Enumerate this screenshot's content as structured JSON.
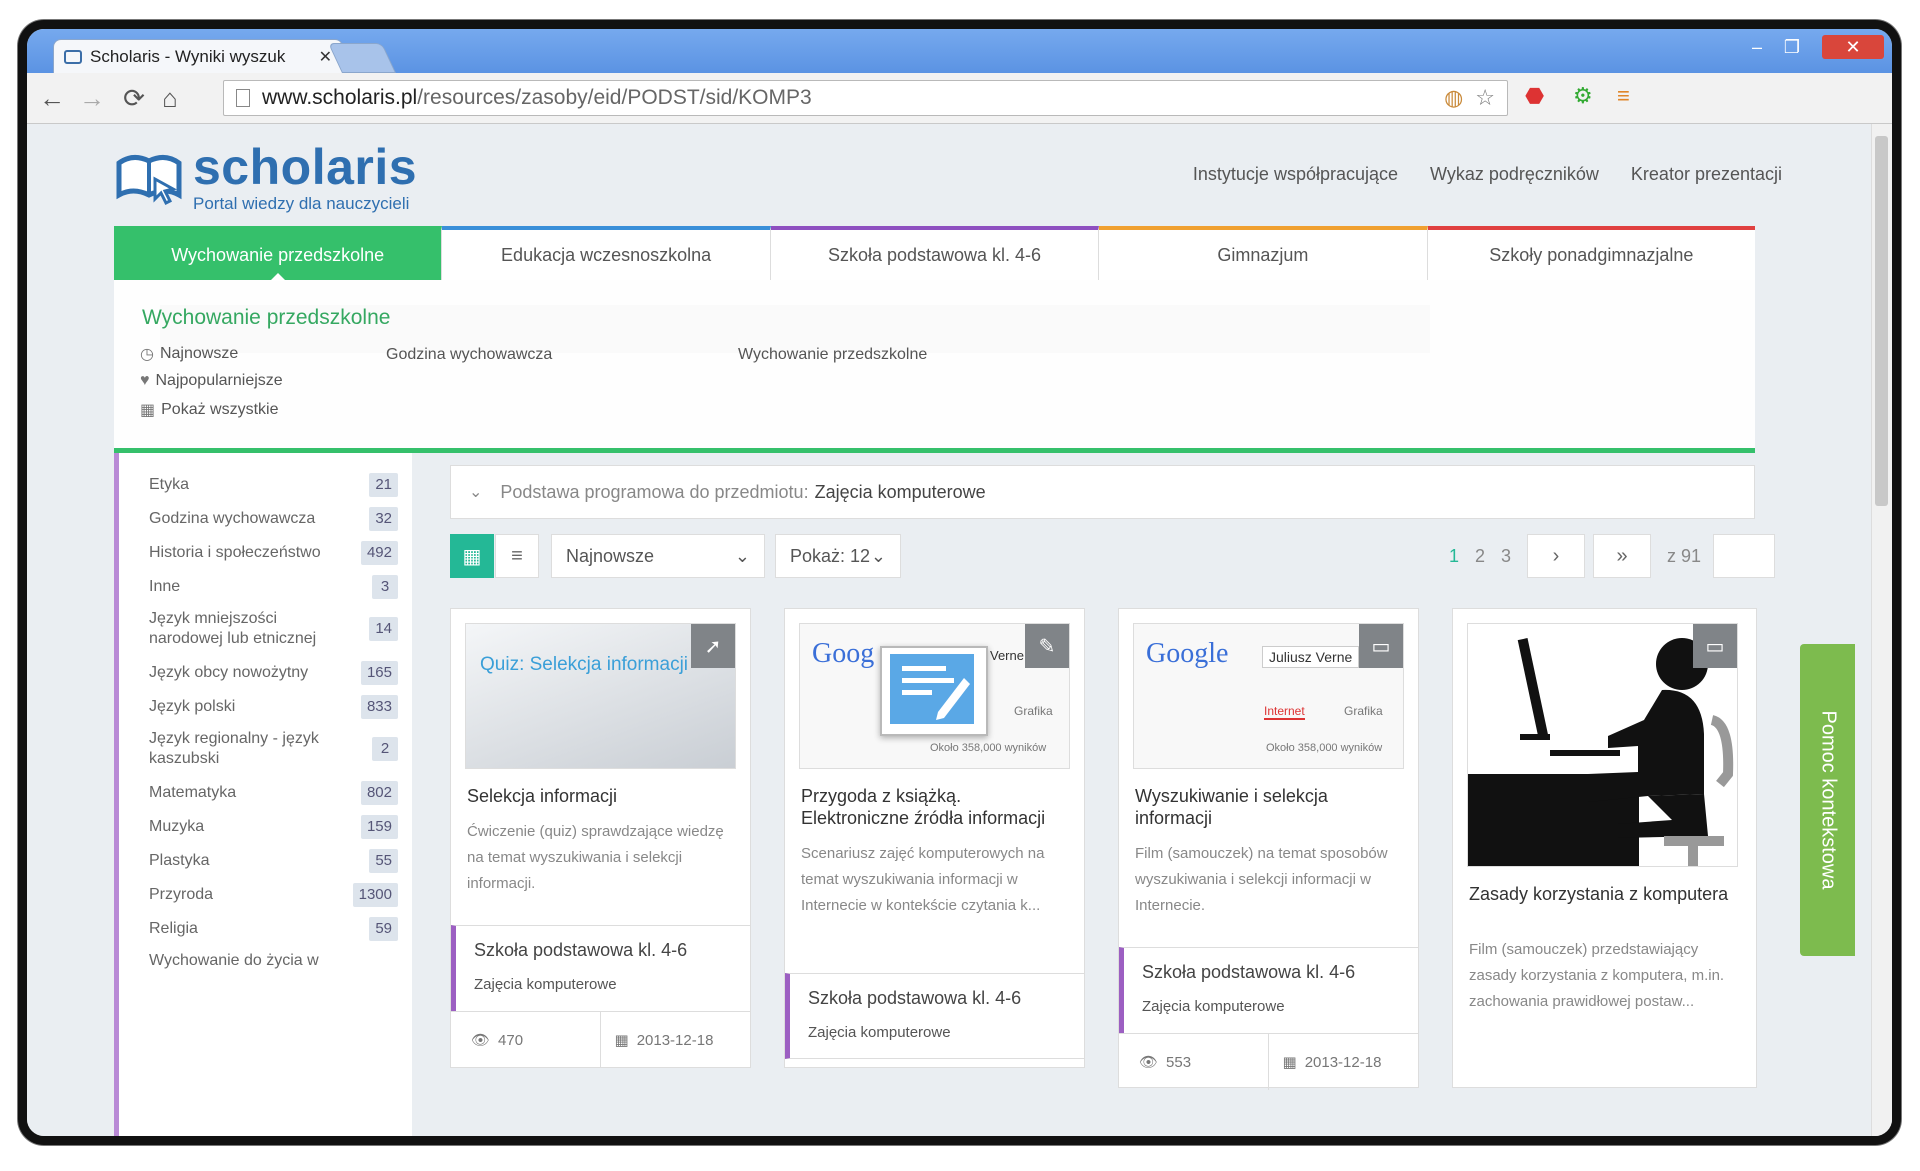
{
  "browser": {
    "tab_title": "Scholaris - Wyniki wyszuk",
    "url_host": "www.scholaris.pl",
    "url_path": "/resources/zasoby/eid/PODST/sid/KOMP3"
  },
  "header": {
    "logo_name": "scholaris",
    "logo_subtitle": "Portal wiedzy dla nauczycieli",
    "links": [
      "Instytucje współpracujące",
      "Wykaz podręczników",
      "Kreator prezentacji"
    ]
  },
  "levels": [
    {
      "label": "Wychowanie przedszkolne",
      "color": "#35c06b"
    },
    {
      "label": "Edukacja wczesnoszkolna",
      "color": "#3a8fd9"
    },
    {
      "label": "Szkoła podstawowa kl. 4-6",
      "color": "#8e4fc0"
    },
    {
      "label": "Gimnazjum",
      "color": "#f0a030"
    },
    {
      "label": "Szkoły ponadgimnazjalne",
      "color": "#e04040"
    }
  ],
  "dropdown": {
    "title": "Wychowanie przedszkolne",
    "newest": "Najnowsze",
    "popular": "Najpopularniejsze",
    "show_all": "Pokaż wszystkie",
    "col2": "Godzina wychowawcza",
    "col3": "Wychowanie przedszkolne"
  },
  "sidebar": {
    "items": [
      {
        "label": "Etyka",
        "count": "21"
      },
      {
        "label": "Godzina wychowawcza",
        "count": "32"
      },
      {
        "label": "Historia i społeczeństwo",
        "count": "492"
      },
      {
        "label": "Inne",
        "count": "3"
      },
      {
        "label": "Język mniejszości narodowej lub etnicznej",
        "count": "14"
      },
      {
        "label": "Język obcy nowożytny",
        "count": "165"
      },
      {
        "label": "Język polski",
        "count": "833"
      },
      {
        "label": "Język regionalny - język kaszubski",
        "count": "2"
      },
      {
        "label": "Matematyka",
        "count": "802"
      },
      {
        "label": "Muzyka",
        "count": "159"
      },
      {
        "label": "Plastyka",
        "count": "55"
      },
      {
        "label": "Przyroda",
        "count": "1300"
      },
      {
        "label": "Religia",
        "count": "59"
      },
      {
        "label": "Wychowanie do życia w",
        "count": ""
      }
    ]
  },
  "curriculum": {
    "label": "Podstawa programowa do przedmiotu:",
    "subject": "Zajęcia komputerowe"
  },
  "controls": {
    "sort": "Najnowsze",
    "show": "Pokaż: 12",
    "pages": [
      "1",
      "2",
      "3"
    ],
    "next": "›",
    "last": "»",
    "of_total": "z 91"
  },
  "cards": [
    {
      "thumb_text": "Quiz: Selekcja informacji",
      "title": "Selekcja informacji",
      "desc": "Ćwiczenie (quiz) sprawdzające wiedzę na temat wyszukiwania i selekcji informacji.",
      "level": "Szkoła podstawowa kl. 4-6",
      "subject": "Zajęcia komputerowe",
      "views": "470",
      "date": "2013-12-18"
    },
    {
      "thumb_text": "Goog",
      "thumb_extra": "Verne",
      "thumb_tab": "Grafika",
      "thumb_results": "Około 358,000 wyników",
      "title": "Przygoda z książką. Elektroniczne źródła informacji",
      "desc": "Scenariusz zajęć komputerowych na temat wyszukiwania informacji w Internecie w kontekście czytania k...",
      "level": "Szkoła podstawowa kl. 4-6",
      "subject": "Zajęcia komputerowe"
    },
    {
      "thumb_text": "Google",
      "thumb_query": "Juliusz Verne",
      "thumb_tab1": "Internet",
      "thumb_tab2": "Grafika",
      "thumb_results": "Około 358,000 wyników",
      "title": "Wyszukiwanie i selekcja informacji",
      "desc": "Film (samouczek) na temat sposobów wyszukiwania i selekcji informacji w Internecie.",
      "level": "Szkoła podstawowa kl. 4-6",
      "subject": "Zajęcia komputerowe",
      "views": "553",
      "date": "2013-12-18"
    },
    {
      "title": "Zasady korzystania z komputera",
      "desc": "Film (samouczek) przedstawiający zasady korzystania z komputera, m.in. zachowania prawidłowej postaw..."
    }
  ],
  "help_tab": "Pomoc kontekstowa"
}
